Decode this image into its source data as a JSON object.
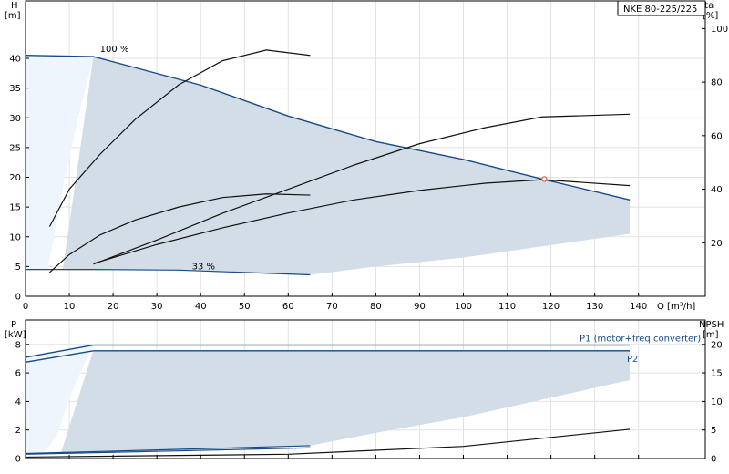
{
  "chart_data": [
    {
      "type": "line",
      "model_label": "NKE 80-225/225",
      "x_label": "Q [m³/h]",
      "xlim": [
        0,
        140
      ],
      "x_ticks": [
        0,
        10,
        20,
        30,
        40,
        50,
        60,
        70,
        80,
        90,
        100,
        110,
        120,
        130,
        140
      ],
      "y_label_left": [
        "H",
        "[m]"
      ],
      "ylim_left": [
        0,
        45
      ],
      "y_ticks_left": [
        0,
        5,
        10,
        15,
        20,
        25,
        30,
        35,
        40
      ],
      "y_label_right": [
        "eta",
        "[%]"
      ],
      "ylim_right": [
        0,
        100
      ],
      "y_ticks_right": [
        20,
        40,
        60,
        80,
        100
      ],
      "grid": true,
      "speed_labels": [
        {
          "text": "100 %",
          "x": 17,
          "y": 41.5
        },
        {
          "text": "33 %",
          "x": 38,
          "y": 5
        }
      ],
      "operating_area": {
        "outline": [
          [
            15.5,
            40.3
          ],
          [
            40,
            35.5
          ],
          [
            60,
            30.3
          ],
          [
            80,
            26
          ],
          [
            100,
            23
          ],
          [
            118,
            19.7
          ],
          [
            138,
            16.2
          ],
          [
            138,
            10.5
          ],
          [
            100,
            6.5
          ],
          [
            80,
            5
          ],
          [
            65,
            3.6
          ],
          [
            35,
            4.4
          ],
          [
            15.5,
            4.4
          ],
          [
            8.5,
            4.4
          ]
        ],
        "color": "#d3dde8"
      },
      "series": [
        {
          "role": "head-max",
          "x": [
            0,
            15.5
          ],
          "y": [
            40.5,
            40.3
          ],
          "color": "#174b87"
        },
        {
          "role": "head-max",
          "x": [
            15.5,
            40,
            60,
            80,
            100,
            118,
            138
          ],
          "y": [
            40.3,
            35.5,
            30.3,
            26,
            23,
            19.7,
            16.2
          ],
          "color": "#174b87"
        },
        {
          "role": "head-min",
          "x": [
            0,
            15,
            35,
            50,
            65
          ],
          "y": [
            4.5,
            4.5,
            4.4,
            4.0,
            3.6
          ],
          "color": "#174b87"
        },
        {
          "role": "head-internal",
          "x": [
            5.5,
            10,
            17,
            25,
            35,
            45,
            55,
            65
          ],
          "y": [
            4.0,
            7.0,
            10.3,
            12.8,
            15.0,
            16.6,
            17.2,
            17.0
          ],
          "color": "#111111"
        },
        {
          "role": "eff-internal",
          "x": [
            5.5,
            10,
            17,
            25,
            35,
            45,
            55,
            65
          ],
          "y": [
            26,
            40,
            53,
            66,
            79,
            88,
            92,
            90
          ],
          "color": "#111111"
        },
        {
          "role": "head-external",
          "x": [
            15.5,
            30,
            45,
            60,
            75,
            90,
            105,
            118,
            138
          ],
          "y": [
            5.5,
            8.7,
            11.5,
            14.0,
            16.2,
            17.8,
            19.0,
            19.6,
            18.6
          ],
          "color": "#111111"
        },
        {
          "role": "eff-external",
          "x": [
            15.5,
            30,
            45,
            60,
            75,
            90,
            105,
            118,
            138
          ],
          "y": [
            12,
            21,
            31,
            40,
            49,
            57,
            63,
            67,
            68
          ],
          "color": "#111111"
        }
      ],
      "duty_point": {
        "x": 118.5,
        "y": 19.7,
        "color": "#e05a4a"
      }
    },
    {
      "type": "line",
      "xlim": [
        0,
        140
      ],
      "y_label_left": [
        "P",
        "[kW]"
      ],
      "ylim_left": [
        0,
        9
      ],
      "y_ticks_left": [
        0,
        2,
        4,
        6,
        8
      ],
      "y_label_right": [
        "NPSH",
        "[m]"
      ],
      "ylim_right": [
        0,
        22.5
      ],
      "y_ticks_right": [
        0,
        5,
        10,
        15,
        20
      ],
      "grid": true,
      "operating_area": {
        "outline": [
          [
            15.5,
            7.6
          ],
          [
            138,
            7.6
          ],
          [
            138,
            5.5
          ],
          [
            100,
            2.9
          ],
          [
            80,
            1.8
          ],
          [
            65,
            0.9
          ],
          [
            40,
            0.6
          ],
          [
            15.5,
            0.4
          ],
          [
            8,
            0.3
          ]
        ],
        "color": "#d3dde8"
      },
      "series": [
        {
          "name": "P1 (motor+freq.converter)",
          "x": [
            0,
            15.5,
            138
          ],
          "y": [
            7.1,
            7.95,
            7.95
          ],
          "color": "#174b87"
        },
        {
          "name": "P2",
          "x": [
            0,
            15.5,
            138
          ],
          "y": [
            6.75,
            7.55,
            7.55
          ],
          "color": "#174b87"
        },
        {
          "role": "p1-min",
          "x": [
            0,
            30,
            65
          ],
          "y": [
            0.35,
            0.6,
            0.9
          ],
          "color": "#174b87"
        },
        {
          "role": "p2-min",
          "x": [
            0,
            30,
            65
          ],
          "y": [
            0.3,
            0.5,
            0.75
          ],
          "color": "#174b87"
        },
        {
          "role": "npsh",
          "x": [
            0,
            60,
            100,
            138
          ],
          "y": [
            0.1,
            0.3,
            0.85,
            2.05
          ],
          "color": "#111111"
        }
      ]
    }
  ]
}
